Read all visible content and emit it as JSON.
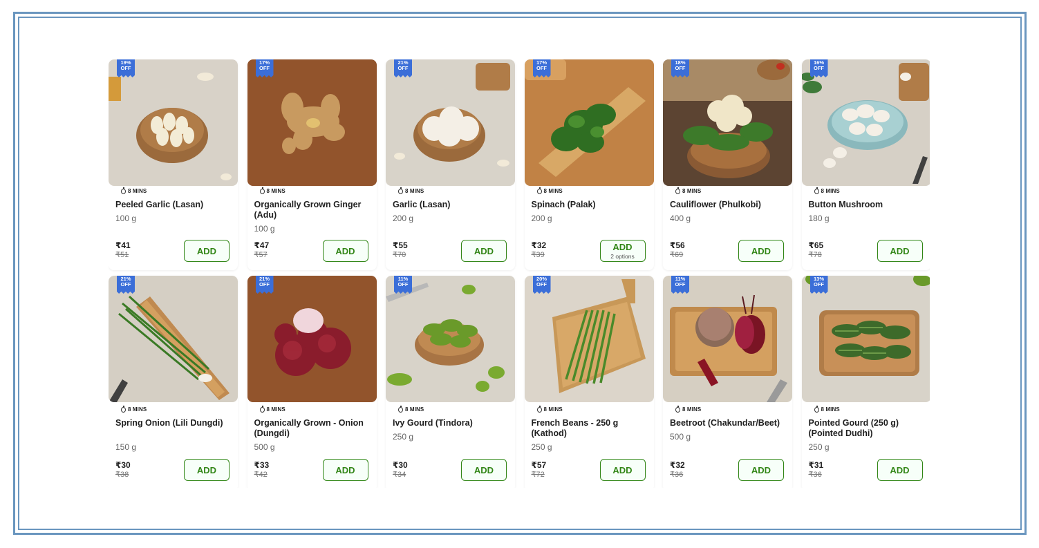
{
  "products": [
    {
      "discount": "19%",
      "off": "OFF",
      "eta": "8 MINS",
      "name": "Peeled Garlic (Lasan)",
      "weight": "100 g",
      "price": "₹41",
      "mrp": "₹51",
      "add": "ADD",
      "options": "",
      "art": "garlic-peeled"
    },
    {
      "discount": "17%",
      "off": "OFF",
      "eta": "8 MINS",
      "name": "Organically Grown Ginger (Adu)",
      "weight": "100 g",
      "price": "₹47",
      "mrp": "₹57",
      "add": "ADD",
      "options": "",
      "art": "ginger"
    },
    {
      "discount": "21%",
      "off": "OFF",
      "eta": "8 MINS",
      "name": "Garlic (Lasan)",
      "weight": "200 g",
      "price": "₹55",
      "mrp": "₹70",
      "add": "ADD",
      "options": "",
      "art": "garlic"
    },
    {
      "discount": "17%",
      "off": "OFF",
      "eta": "8 MINS",
      "name": "Spinach (Palak)",
      "weight": "200 g",
      "price": "₹32",
      "mrp": "₹39",
      "add": "ADD",
      "options": "2 options",
      "art": "spinach"
    },
    {
      "discount": "18%",
      "off": "OFF",
      "eta": "8 MINS",
      "name": "Cauliflower (Phulkobi)",
      "weight": "400 g",
      "price": "₹56",
      "mrp": "₹69",
      "add": "ADD",
      "options": "",
      "art": "cauliflower"
    },
    {
      "discount": "16%",
      "off": "OFF",
      "eta": "8 MINS",
      "name": "Button Mushroom",
      "weight": "180 g",
      "price": "₹65",
      "mrp": "₹78",
      "add": "ADD",
      "options": "",
      "art": "mushroom"
    },
    {
      "discount": "21%",
      "off": "OFF",
      "eta": "8 MINS",
      "name": "Spring Onion (Lili Dungdi)",
      "weight": "150 g",
      "price": "₹30",
      "mrp": "₹38",
      "add": "ADD",
      "options": "",
      "art": "spring-onion"
    },
    {
      "discount": "21%",
      "off": "OFF",
      "eta": "8 MINS",
      "name": "Organically Grown - Onion (Dungdi)",
      "weight": "500 g",
      "price": "₹33",
      "mrp": "₹42",
      "add": "ADD",
      "options": "",
      "art": "onion"
    },
    {
      "discount": "11%",
      "off": "OFF",
      "eta": "8 MINS",
      "name": "Ivy Gourd (Tindora)",
      "weight": "250 g",
      "price": "₹30",
      "mrp": "₹34",
      "add": "ADD",
      "options": "",
      "art": "ivy-gourd"
    },
    {
      "discount": "20%",
      "off": "OFF",
      "eta": "8 MINS",
      "name": "French Beans - 250 g (Kathod)",
      "weight": "250 g",
      "price": "₹57",
      "mrp": "₹72",
      "add": "ADD",
      "options": "",
      "art": "beans"
    },
    {
      "discount": "11%",
      "off": "OFF",
      "eta": "8 MINS",
      "name": "Beetroot (Chakundar/Beet)",
      "weight": "500 g",
      "price": "₹32",
      "mrp": "₹36",
      "add": "ADD",
      "options": "",
      "art": "beetroot"
    },
    {
      "discount": "13%",
      "off": "OFF",
      "eta": "8 MINS",
      "name": "Pointed Gourd (250 g) (Pointed Dudhi)",
      "weight": "250 g",
      "price": "₹31",
      "mrp": "₹36",
      "add": "ADD",
      "options": "",
      "art": "pointed-gourd"
    }
  ],
  "colors": {
    "accent": "#318616",
    "badge": "#3b6ed8",
    "frame": "#6a96bf"
  }
}
